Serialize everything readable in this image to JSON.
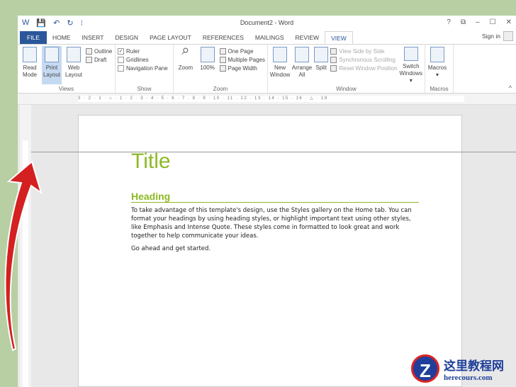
{
  "window": {
    "title": "Document2 - Word",
    "help": "?",
    "restore": "⧉",
    "minimize": "–",
    "maximize": "☐",
    "close": "✕",
    "sign_in": "Sign in"
  },
  "quick_access": {
    "word": "W",
    "save": "💾",
    "undo": "↶",
    "redo": "↻",
    "more": "⁝"
  },
  "tabs": [
    "FILE",
    "HOME",
    "INSERT",
    "DESIGN",
    "PAGE LAYOUT",
    "REFERENCES",
    "MAILINGS",
    "REVIEW",
    "VIEW"
  ],
  "ribbon": {
    "views": {
      "label": "Views",
      "read_mode": "Read Mode",
      "print_layout": "Print Layout",
      "web_layout": "Web Layout",
      "outline": "Outline",
      "draft": "Draft"
    },
    "show": {
      "label": "Show",
      "ruler": "Ruler",
      "gridlines": "Gridlines",
      "navigation_pane": "Navigation Pane"
    },
    "zoom": {
      "label": "Zoom",
      "zoom": "Zoom",
      "hundred": "100%",
      "one_page": "One Page",
      "multiple_pages": "Multiple Pages",
      "page_width": "Page Width"
    },
    "window": {
      "label": "Window",
      "new_window": "New Window",
      "arrange_all": "Arrange All",
      "split": "Split",
      "side_by_side": "View Side by Side",
      "sync_scroll": "Synchronous Scrolling",
      "reset_pos": "Reset Window Position",
      "switch_windows": "Switch Windows ▾"
    },
    "macros": {
      "label": "Macros",
      "macros": "Macros ▾"
    },
    "collapse": "^"
  },
  "ruler_text": "3 · 2 · 1 · ⌂ · 1 · 2 · 3 · 4 · 5 · 6 · 7 · 8 · 9 · 10 · 11 · 12 · 13 · 14 · 15 · 16 · △ · 18",
  "document": {
    "title": "Title",
    "heading": "Heading",
    "para1": "To take advantage of this template's design, use the Styles gallery on the Home tab. You can format your headings by using heading styles, or highlight important text using other styles, like Emphasis and Intense Quote. These styles come in formatted to look great and work together to help communicate your ideas.",
    "para2": "Go ahead and get started."
  },
  "watermark": {
    "logo": "Z",
    "name": "这里教程网",
    "url": "herecours.com"
  },
  "colors": {
    "accent": "#2b579a",
    "heading": "#8cba26",
    "arrow": "#d42020",
    "background": "#b7cfa3"
  }
}
